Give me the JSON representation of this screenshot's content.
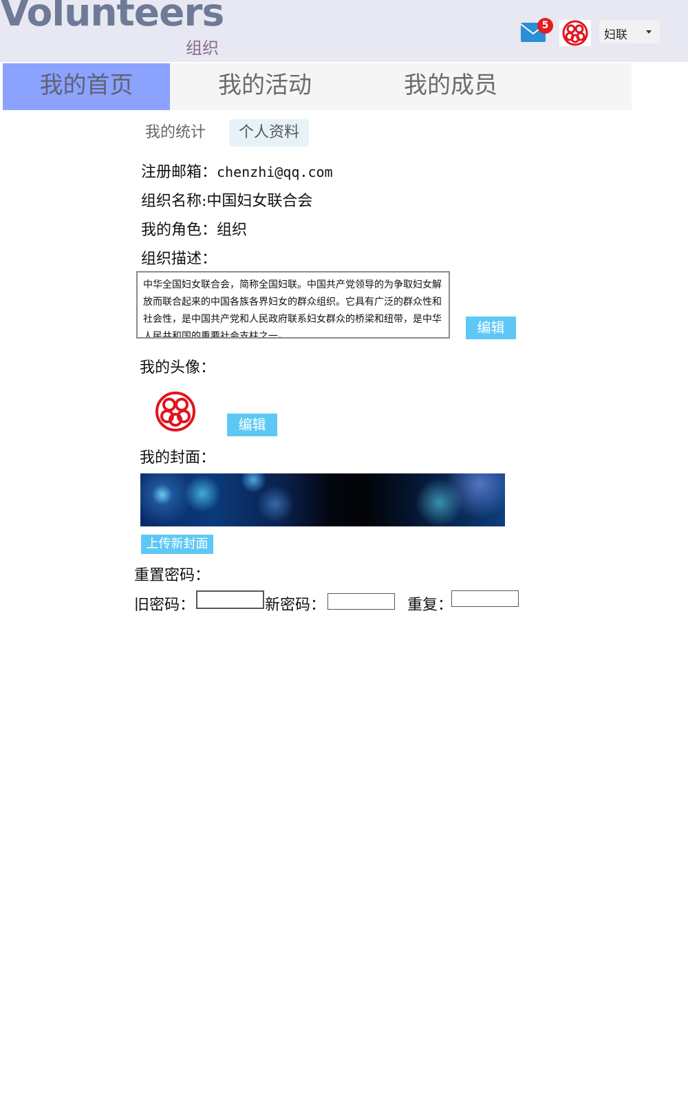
{
  "header": {
    "brand": "Volunteers",
    "brand_sub": "组织",
    "mail_count": "5",
    "user_name": "妇联"
  },
  "nav": {
    "tabs": [
      {
        "label": "我的首页",
        "active": true
      },
      {
        "label": "我的活动",
        "active": false
      },
      {
        "label": "我的成员",
        "active": false
      }
    ]
  },
  "subtabs": [
    {
      "label": "我的统计",
      "active": false
    },
    {
      "label": "个人资料",
      "active": true
    }
  ],
  "profile": {
    "email_label": "注册邮箱：",
    "email": "chenzhi@qq.com",
    "org_name_label": "组织名称:",
    "org_name": "中国妇女联合会",
    "role_label": "我的角色：",
    "role": "组织",
    "desc_label": "组织描述：",
    "description": "中华全国妇女联合会，简称全国妇联。中国共产党领导的为争取妇女解放而联合起来的中国各族各界妇女的群众组织。它具有广泛的群众性和社会性，是中国共产党和人民政府联系妇女群众的桥梁和纽带，是中华人民共和国的重要社会支柱之一。",
    "desc_edit": "编辑",
    "avatar_label": "我的头像：",
    "avatar_edit": "编辑",
    "cover_label": "我的封面：",
    "cover_upload": "上传新封面"
  },
  "password": {
    "section_label": "重置密码：",
    "old_label": "旧密码：",
    "new_label": "新密码：",
    "repeat_label": "重复：",
    "old_value": "",
    "new_value": "",
    "repeat_value": ""
  },
  "colors": {
    "accent_blue": "#5ec8f5",
    "active_tab": "#8ba2ff",
    "badge_red": "#e51d1d",
    "logo_red": "#e0141e"
  },
  "icons": {
    "mail": "mail-icon",
    "logo": "womens-federation-logo-icon",
    "dropdown": "caret-down-icon"
  }
}
